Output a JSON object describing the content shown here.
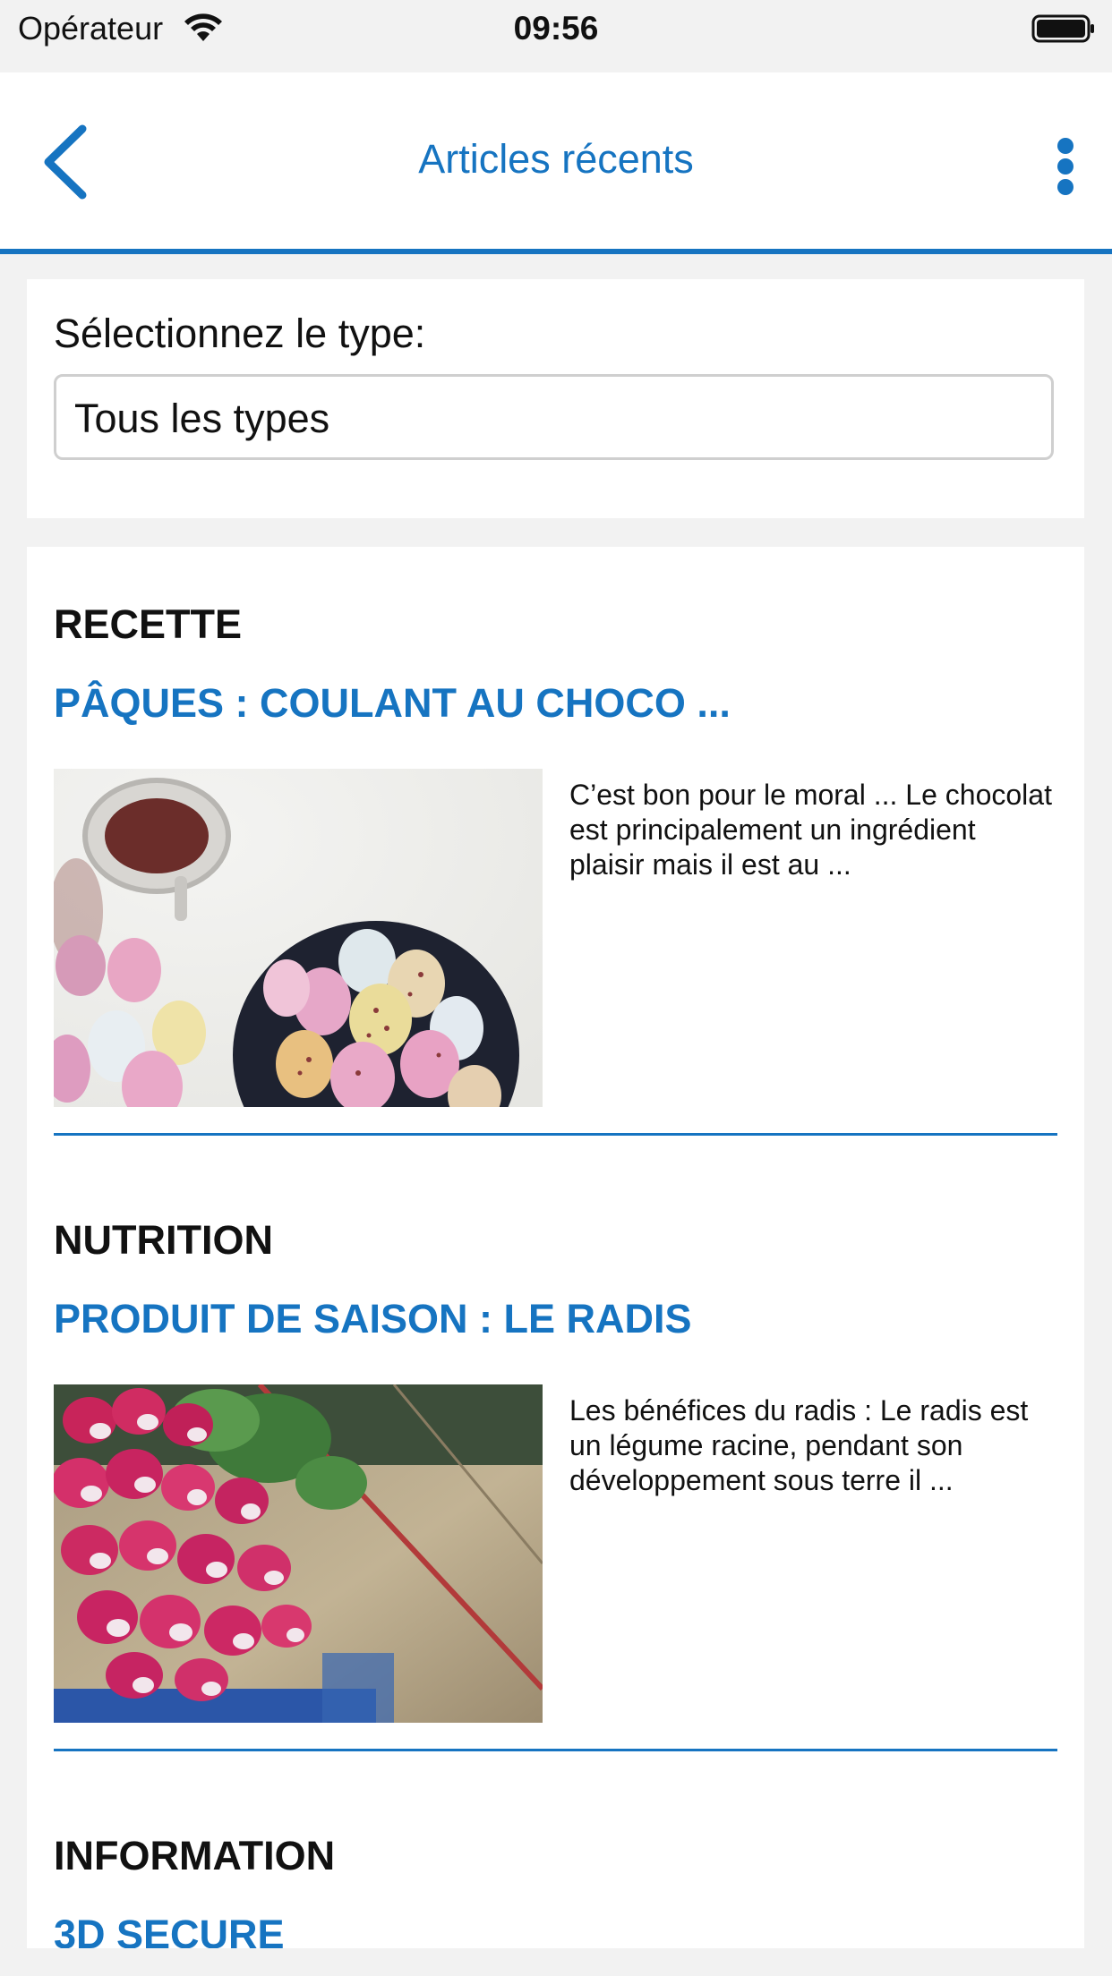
{
  "status_bar": {
    "carrier": "Opérateur",
    "time": "09:56"
  },
  "nav": {
    "title": "Articles récents",
    "back_icon": "chevron-left-icon",
    "menu_icon": "more-vertical-icon"
  },
  "filter": {
    "label": "Sélectionnez le type:",
    "selected": "Tous les types"
  },
  "articles": [
    {
      "type": "RECETTE",
      "title": "PÂQUES : COULANT AU CHOCO ...",
      "excerpt": "C’est bon pour le moral ... Le chocolat est principalement un ingrédient plaisir mais il est au ...",
      "image": "easter-eggs-photo"
    },
    {
      "type": "NUTRITION",
      "title": "PRODUIT DE SAISON : LE RADIS",
      "excerpt": "Les bénéfices du radis : Le radis est un légume racine, pendant son développement sous terre il ...",
      "image": "radishes-photo"
    },
    {
      "type": "INFORMATION",
      "title": "3D SECURE"
    }
  ],
  "colors": {
    "accent": "#1674c1",
    "background": "#f2f2f2"
  }
}
